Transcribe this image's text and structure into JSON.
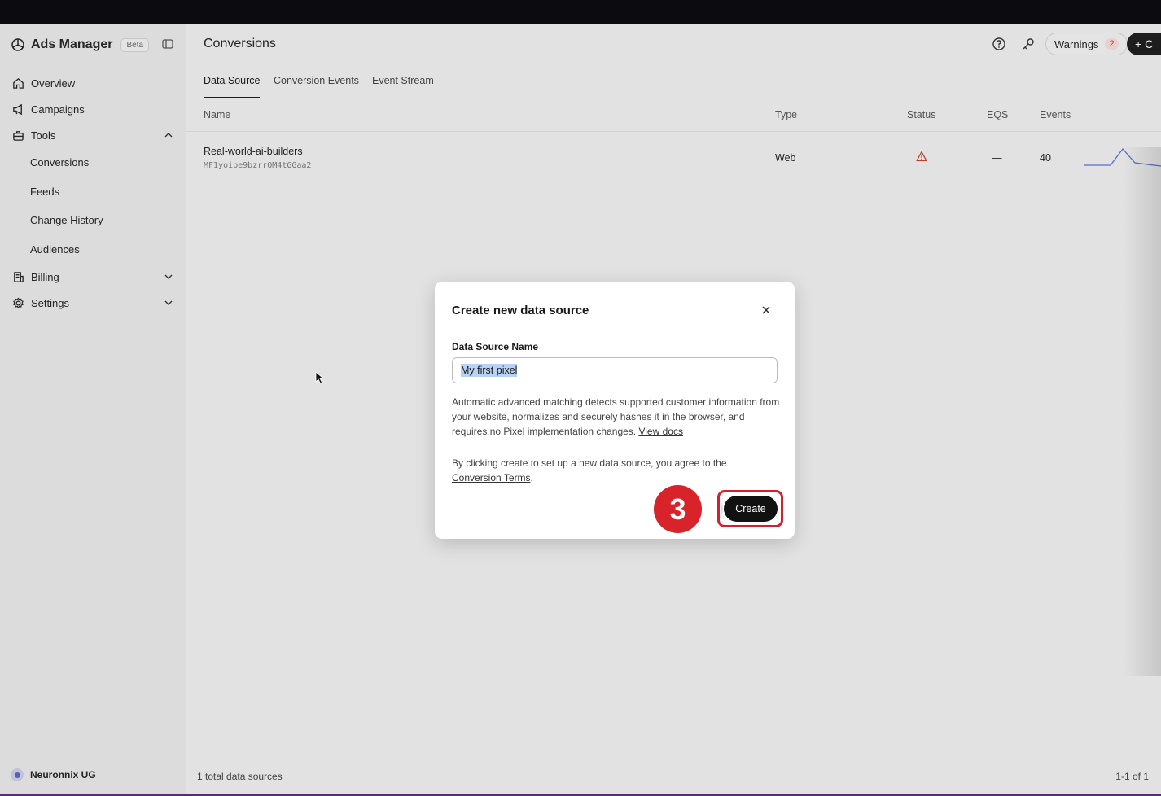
{
  "app": {
    "title": "Ads Manager",
    "badge": "Beta"
  },
  "sidebar": {
    "items": [
      {
        "label": "Overview",
        "icon": "home-icon"
      },
      {
        "label": "Campaigns",
        "icon": "megaphone-icon"
      },
      {
        "label": "Tools",
        "icon": "toolbox-icon",
        "expanded": true
      },
      {
        "label": "Billing",
        "icon": "receipt-icon",
        "expanded": false
      },
      {
        "label": "Settings",
        "icon": "gear-icon",
        "expanded": false
      }
    ],
    "tools_sub": [
      "Conversions",
      "Feeds",
      "Change History",
      "Audiences"
    ],
    "org_name": "Neuronnix UG"
  },
  "header": {
    "title": "Conversions",
    "warnings_label": "Warnings",
    "warnings_count": "2",
    "create_label": "+ C"
  },
  "tabs": [
    "Data Source",
    "Conversion Events",
    "Event Stream"
  ],
  "table": {
    "columns": [
      "Name",
      "Type",
      "Status",
      "EQS",
      "Events"
    ],
    "rows": [
      {
        "name": "Real-world-ai-builders",
        "id": "MF1yoipe9bzrrQM4tGGaa2",
        "type": "Web",
        "status": "warning",
        "eqs": "—",
        "events": "40"
      }
    ]
  },
  "footer": {
    "total": "1 total data sources",
    "pagination": "1-1 of 1"
  },
  "modal": {
    "title": "Create new data source",
    "field_label": "Data Source Name",
    "field_value": "My first pixel",
    "info_text": "Automatic advanced matching detects supported customer information from your website, normalizes and securely hashes it in the browser, and requires no Pixel implementation changes.",
    "view_docs": "View docs",
    "terms_text": "By clicking create to set up a new data source, you agree to the",
    "terms_link": "Conversion Terms",
    "terms_end": ".",
    "create_label": "Create"
  },
  "annotation": {
    "step": "3"
  },
  "colors": {
    "accent_red": "#d8232a",
    "dark_button": "#111111",
    "selection": "#b8d2f5"
  }
}
